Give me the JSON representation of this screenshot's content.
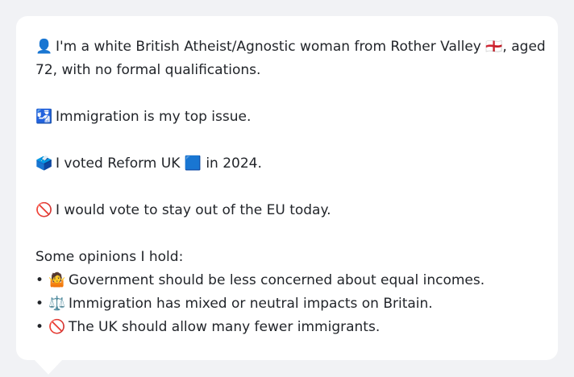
{
  "bio": {
    "line1": "I'm a white British Atheist/Agnostic woman from Rother Valley 🏴󠁧󠁢󠁥󠁮󠁧󠁿, aged",
    "line2": "72, with no formal qualifications.",
    "icon": "👤"
  },
  "top_issue": {
    "icon": "🛂",
    "text": "Immigration is my top issue."
  },
  "vote": {
    "icon": "🗳️",
    "text_before": "I voted Reform UK",
    "party_icon": "🟦",
    "text_after": "in 2024."
  },
  "eu": {
    "icon": "🚫",
    "text": "I would vote to stay out of the EU today."
  },
  "opinions": {
    "heading": "Some opinions I hold:",
    "bullet": "•",
    "items": [
      {
        "icon": "🤷",
        "text": "Government should be less concerned about equal incomes."
      },
      {
        "icon": "⚖️",
        "text": "Immigration has mixed or neutral impacts on Britain."
      },
      {
        "icon": "🚫",
        "text": "The UK should allow many fewer immigrants."
      }
    ]
  },
  "colors": {
    "background": "#f1f2f5",
    "card": "#ffffff",
    "text": "#22252a"
  }
}
